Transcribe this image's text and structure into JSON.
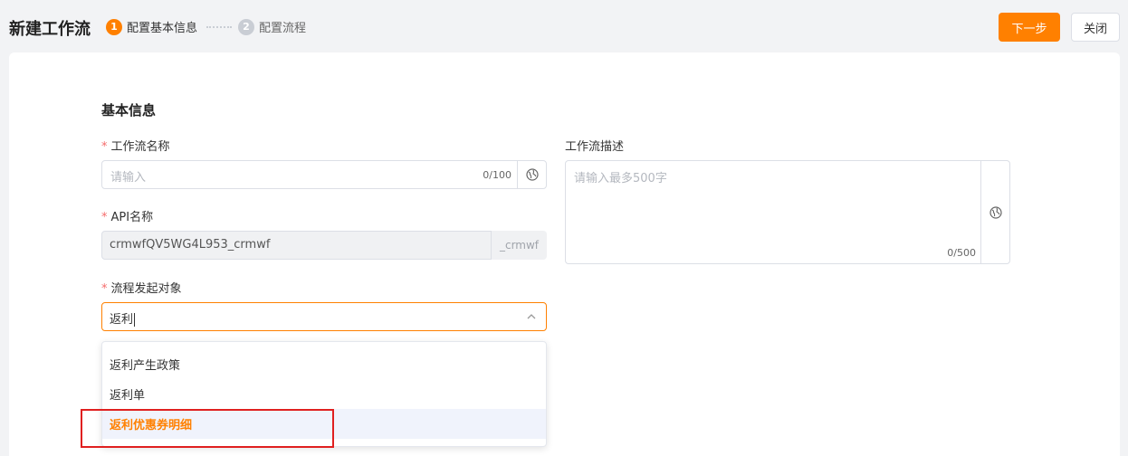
{
  "header": {
    "title": "新建工作流",
    "steps": [
      {
        "num": "1",
        "label": "配置基本信息"
      },
      {
        "num": "2",
        "label": "配置流程"
      }
    ],
    "next_label": "下一步",
    "close_label": "关闭"
  },
  "form": {
    "section_title": "基本信息",
    "required_mark": "*",
    "workflow_name": {
      "label": "工作流名称",
      "placeholder": "请输入",
      "counter": "0/100"
    },
    "api_name": {
      "label": "API名称",
      "value": "crmwfQV5WG4L953_crmwf",
      "suffix": "_crmwf"
    },
    "trigger_object": {
      "label": "流程发起对象",
      "value": "返利",
      "options": [
        "返利产生政策",
        "返利单",
        "返利优惠券明细"
      ],
      "highlighted_index": 2
    },
    "description": {
      "label": "工作流描述",
      "placeholder": "请输入最多500字",
      "counter": "0/500"
    }
  },
  "colors": {
    "accent": "#ff8000",
    "highlight_bg": "#f0f3fc",
    "annotation_box": "#e02020"
  },
  "icons": {
    "globe": "globe-icon",
    "chevron": "chevron-up-icon"
  }
}
